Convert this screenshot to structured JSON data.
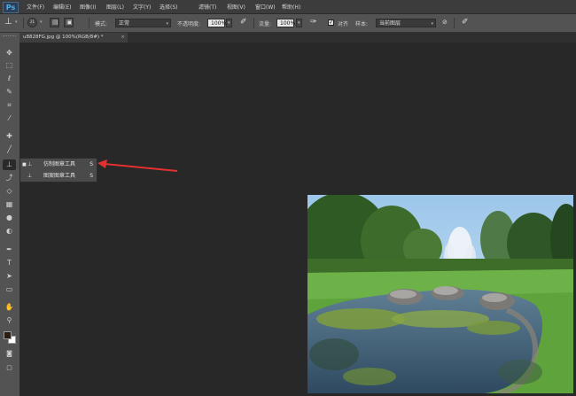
{
  "app": {
    "logo": "Ps"
  },
  "menus": [
    "文件(F)",
    "编辑(E)",
    "图像(I)",
    "图层(L)",
    "文字(Y)",
    "选择(S)",
    "滤镜(T)",
    "视图(V)",
    "窗口(W)",
    "帮助(H)"
  ],
  "options": {
    "brush_size": "21",
    "mode_label": "模式:",
    "mode_value": "正常",
    "opacity_label": "不透明度:",
    "opacity_value": "100%",
    "flow_label": "流量:",
    "flow_value": "100%",
    "aligned_label": "对齐",
    "aligned_checked": true,
    "sample_label": "样本:",
    "sample_value": "当前图层"
  },
  "document": {
    "tab_title": "u8828FG.jpg @ 100%(RGB/8#) *",
    "close": "×"
  },
  "flyout": [
    {
      "label": "仿制图章工具",
      "key": "S",
      "selected": true
    },
    {
      "label": "图案图章工具",
      "key": "S",
      "selected": false
    }
  ],
  "colors": {
    "foreground": "#2b1d12",
    "background": "#ffffff",
    "arrow": "#e53030"
  },
  "toolbar_icons": [
    "move-icon",
    "marquee-icon",
    "lasso-icon",
    "quick-select-icon",
    "crop-icon",
    "eyedropper-icon",
    "healing-brush-icon",
    "brush-icon",
    "clone-stamp-icon",
    "history-brush-icon",
    "eraser-icon",
    "gradient-icon",
    "blur-icon",
    "dodge-icon",
    "pen-icon",
    "type-icon",
    "path-select-icon",
    "shape-icon",
    "hand-icon",
    "zoom-icon"
  ]
}
